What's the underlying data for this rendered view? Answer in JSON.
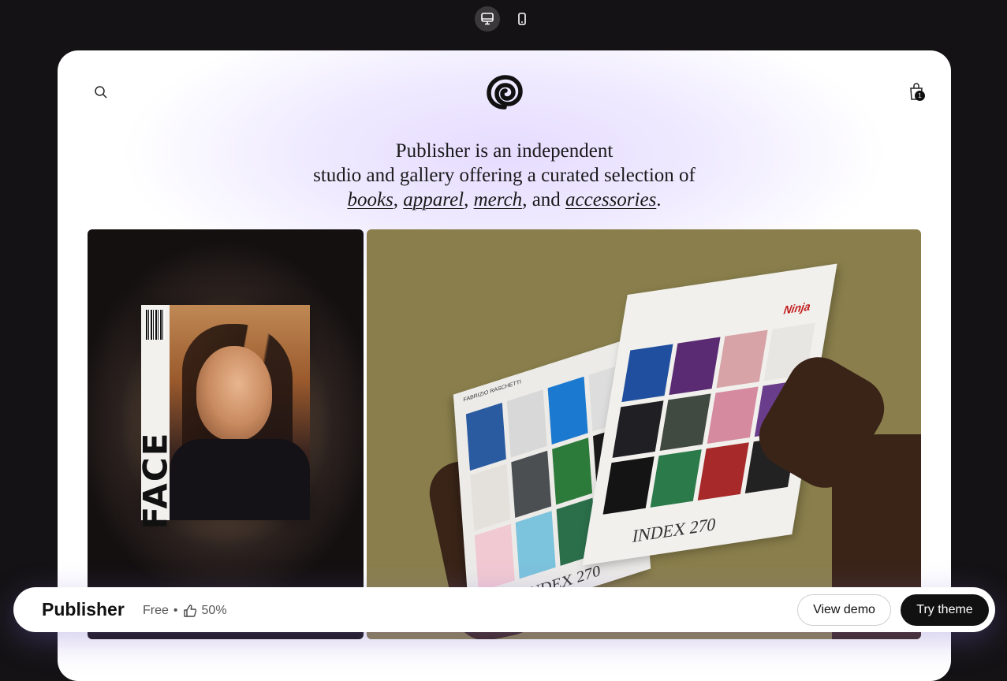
{
  "device_toggle": {
    "desktop_icon": "desktop-icon",
    "mobile_icon": "mobile-icon",
    "active": "desktop"
  },
  "store": {
    "header": {
      "search_icon": "search-icon",
      "logo": "spiral-logo",
      "cart_icon": "bag-icon",
      "cart_count": "1"
    },
    "hero": {
      "line1": "Publisher is an independent",
      "line2": "studio and gallery offering a curated selection of",
      "link_books": "books",
      "sep1": ", ",
      "link_apparel": "apparel",
      "sep2": ", ",
      "link_merch": "merch",
      "sep3": ", and ",
      "link_accessories": "accessories",
      "end": "."
    },
    "images": {
      "left": {
        "magazine_title": "FACE"
      },
      "right": {
        "book_text_left": "FABRIZIO RASCHETTI",
        "book_text_right": "Ninja",
        "book_footer": "INDEX 270"
      }
    }
  },
  "bottom_bar": {
    "theme_name": "Publisher",
    "price": "Free",
    "bullet": "•",
    "rating_icon": "thumbs-up-icon",
    "rating": "50%",
    "view_demo": "View demo",
    "try_theme": "Try theme"
  },
  "colors": {
    "background": "#141214",
    "accent": "#111111",
    "hero_glow": "#e6dcff"
  }
}
